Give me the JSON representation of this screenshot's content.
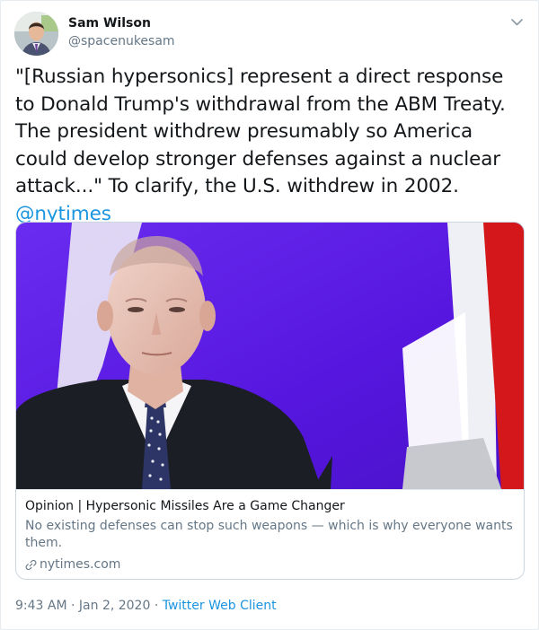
{
  "author": {
    "display_name": "Sam Wilson",
    "handle": "@spacenukesam"
  },
  "tweet": {
    "text_parts": [
      "\"[Russian hypersonics] represent a direct response to Donald Trump's withdrawal from the ABM Treaty. The president withdrew presumably so America could develop stronger defenses against a nuclear attack...\" To clarify, the U.S. withdrew in 2002. ",
      "@nytimes"
    ]
  },
  "card": {
    "title": "Opinion | Hypersonic Missiles Are a Game Changer",
    "description": "No existing defenses can stop such weapons — which is why everyone wants them.",
    "domain": "nytimes.com"
  },
  "footer": {
    "time": "9:43 AM",
    "separator": "·",
    "date": "Jan 2, 2020",
    "client": "Twitter Web Client"
  },
  "icons": {
    "caret": "chevron-down-icon",
    "link": "link-icon"
  },
  "colors": {
    "link": "#1b95e0",
    "secondary_text": "#657786",
    "card_background_purple": "#5a1ee6"
  }
}
